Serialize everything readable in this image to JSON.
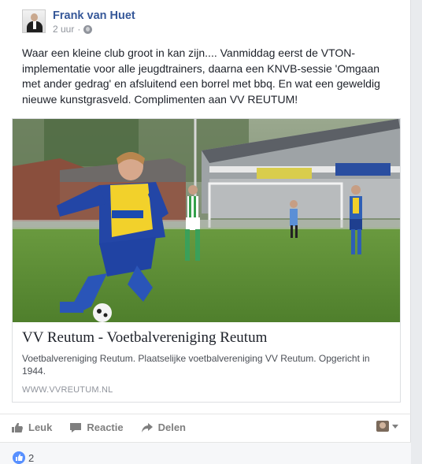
{
  "post": {
    "author": "Frank van Huet",
    "time": "2 uur",
    "separator": "·",
    "privacy_icon": "globe-icon",
    "text": "Waar een kleine club groot in kan zijn.... Vanmiddag eerst de VTON-implementatie voor alle jeugdtrainers, daarna een KNVB-sessie 'Omgaan met ander gedrag' en afsluitend een borrel met bbq. En wat een geweldig nieuwe kunstgrasveld. Complimenten aan VV REUTUM!"
  },
  "link_preview": {
    "image_desc": "youth football player in blue and yellow kit dribbling on artificial turf",
    "title": "VV Reutum - Voetbalvereniging Reutum",
    "description": "Voetbalvereniging Reutum. Plaatselijke voetbalvereniging VV Reutum. Opgericht in 1944.",
    "domain": "WWW.VVREUTUM.NL"
  },
  "actions": {
    "like_label": "Leuk",
    "comment_label": "Reactie",
    "share_label": "Delen"
  },
  "reactions": {
    "like_count": "2"
  },
  "colors": {
    "author_link": "#365899",
    "like_blue": "#5890ff",
    "muted": "#90949c"
  }
}
